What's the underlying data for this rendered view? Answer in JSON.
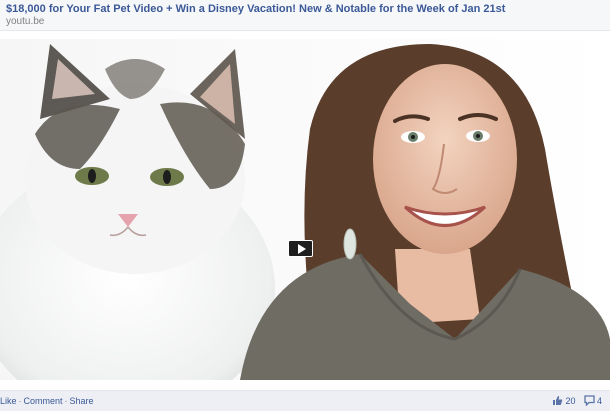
{
  "post": {
    "title": "$18,000 for Your Fat Pet Video + Win a Disney Vacation! New & Notable for the Week of Jan 21st",
    "domain": "youtu.be"
  },
  "video": {
    "play_icon": "play-icon"
  },
  "actions": {
    "like": "Like",
    "comment": "Comment",
    "share": "Share",
    "separator": "·",
    "like_count": "20",
    "comment_count": "4"
  },
  "colors": {
    "link": "#3b5998",
    "bar": "#edeff4",
    "muted": "#808080"
  }
}
